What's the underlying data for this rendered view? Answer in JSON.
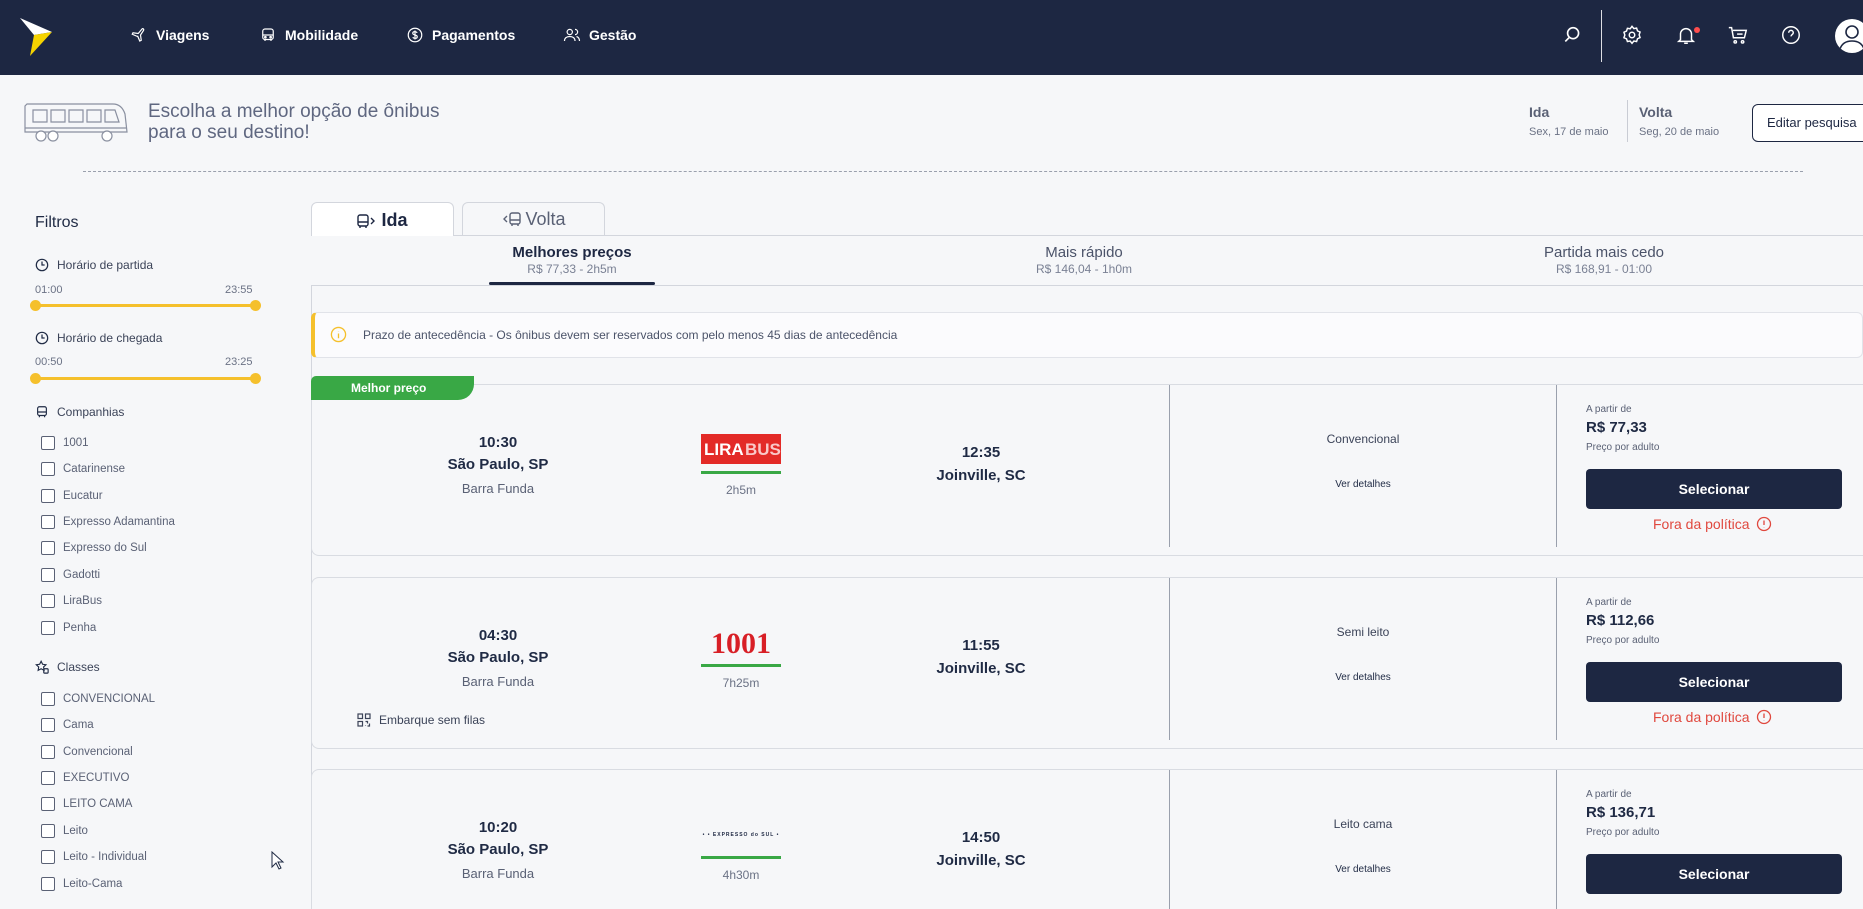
{
  "nav": {
    "items": [
      {
        "label": "Viagens",
        "icon": "airplane-icon"
      },
      {
        "label": "Mobilidade",
        "icon": "car-icon"
      },
      {
        "label": "Pagamentos",
        "icon": "dollar-icon"
      },
      {
        "label": "Gestão",
        "icon": "users-icon"
      }
    ],
    "right_icons": [
      "search-icon",
      "gear-icon",
      "bell-icon",
      "cart-icon",
      "help-icon",
      "user-avatar-icon"
    ]
  },
  "header": {
    "headline": "Escolha a melhor opção de ônibus para o seu destino!",
    "ida_label": "Ida",
    "ida_date": "Sex, 17 de maio",
    "volta_label": "Volta",
    "volta_date": "Seg, 20 de maio",
    "edit_button": "Editar pesquisa"
  },
  "filters": {
    "title": "Filtros",
    "departure": {
      "label": "Horário de partida",
      "min": "01:00",
      "max": "23:55"
    },
    "arrival": {
      "label": "Horário de chegada",
      "min": "00:50",
      "max": "23:25"
    },
    "companies_label": "Companhias",
    "companies": [
      "1001",
      "Catarinense",
      "Eucatur",
      "Expresso Adamantina",
      "Expresso do Sul",
      "Gadotti",
      "LiraBus",
      "Penha"
    ],
    "classes_label": "Classes",
    "classes": [
      "CONVENCIONAL",
      "Cama",
      "Convencional",
      "EXECUTIVO",
      "LEITO CAMA",
      "Leito",
      "Leito - Individual",
      "Leito-Cama"
    ]
  },
  "tabs": {
    "ida": "Ida",
    "volta": "Volta"
  },
  "sort": {
    "options": [
      {
        "title": "Melhores preços",
        "subtitle": "R$ 77,33 - 2h5m"
      },
      {
        "title": "Mais rápido",
        "subtitle": "R$ 146,04 - 1h0m"
      },
      {
        "title": "Partida mais cedo",
        "subtitle": "R$ 168,91 - 01:00"
      }
    ],
    "active_index": 0
  },
  "alert": {
    "text": "Prazo de antecedência - Os ônibus devem ser reservados com pelo menos 45 dias de antecedência"
  },
  "badge": "Melhor preço",
  "common": {
    "from_label": "A partir de",
    "per_adult": "Preço por adulto",
    "select_button": "Selecionar",
    "details_link": "Ver detalhes",
    "out_of_policy": "Fora da política",
    "perk_label": "Embarque sem filas"
  },
  "results": [
    {
      "dep_time": "10:30",
      "dep_city": "São Paulo, SP",
      "dep_station": "Barra Funda",
      "carrier": "LIRABUS",
      "duration": "2h5m",
      "arr_time": "12:35",
      "arr_city": "Joinville, SC",
      "class": "Convencional",
      "price": "R$ 77,33"
    },
    {
      "dep_time": "04:30",
      "dep_city": "São Paulo, SP",
      "dep_station": "Barra Funda",
      "carrier": "1001",
      "duration": "7h25m",
      "arr_time": "11:55",
      "arr_city": "Joinville, SC",
      "class": "Semi leito",
      "price": "R$ 112,66"
    },
    {
      "dep_time": "10:20",
      "dep_city": "São Paulo, SP",
      "dep_station": "Barra Funda",
      "carrier": "EXPRESSO do SUL",
      "duration": "4h30m",
      "arr_time": "14:50",
      "arr_city": "Joinville, SC",
      "class": "Leito cama",
      "price": "R$ 136,71"
    }
  ],
  "colors": {
    "navy": "#1d2742",
    "accent_yellow": "#f5c02c",
    "green": "#39a845",
    "red": "#e0483e"
  }
}
